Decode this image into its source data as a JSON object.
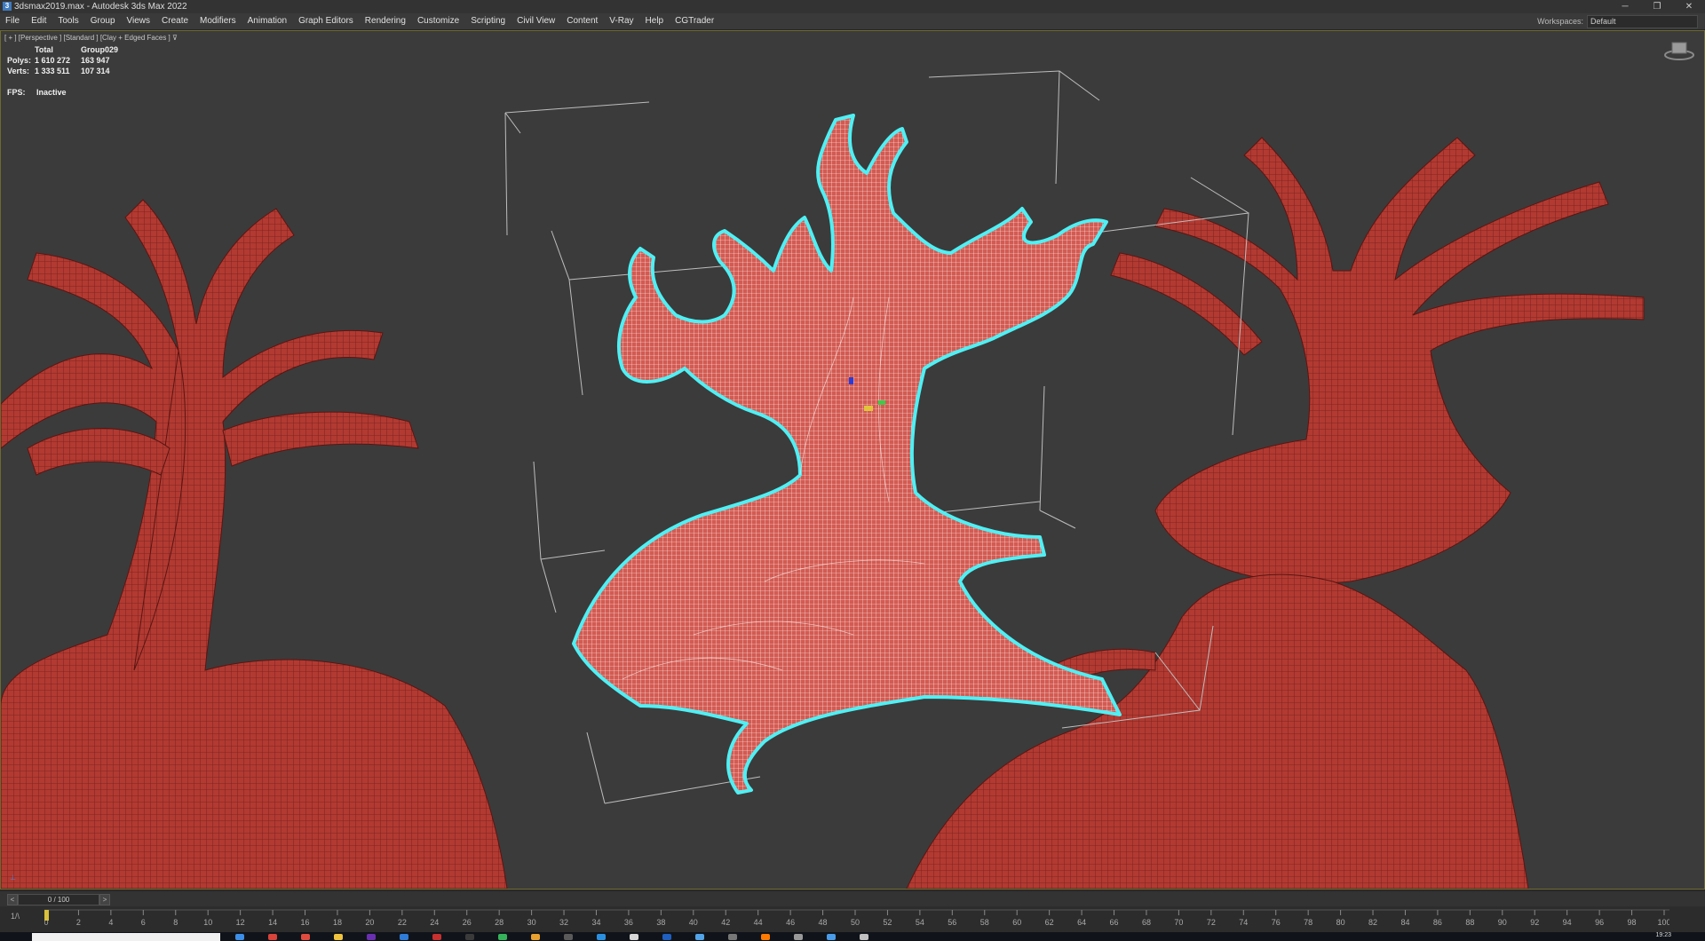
{
  "window": {
    "title": "3dsmax2019.max - Autodesk 3ds Max 2022",
    "icon": "3ds-max-app-icon",
    "buttons": [
      "─",
      "❐",
      "✕"
    ]
  },
  "menu": {
    "items": [
      "File",
      "Edit",
      "Tools",
      "Group",
      "Views",
      "Create",
      "Modifiers",
      "Animation",
      "Graph Editors",
      "Rendering",
      "Customize",
      "Scripting",
      "Civil View",
      "Content",
      "V-Ray",
      "Help",
      "CGTrader"
    ],
    "workspace_label": "Workspaces:",
    "workspace_value": "Default"
  },
  "viewport": {
    "label": "[ + ] [Perspective ] [Standard ] [Clay + Edged Faces ]",
    "filter_icon": "filter-icon",
    "stats": {
      "header": [
        "",
        "Total",
        "Group029"
      ],
      "rows": [
        {
          "label": "Polys:",
          "total": "1 610 272",
          "selected": "163 947"
        },
        {
          "label": "Verts:",
          "total": "1 333 511",
          "selected": "107 314"
        }
      ]
    },
    "fps_label": "FPS:",
    "fps_value": "Inactive",
    "colors": {
      "mesh": "#b23a32",
      "selection_outline": "#4ff0f4",
      "background": "#3b3b3b"
    }
  },
  "timeline": {
    "slider": "0 / 100",
    "prev": "<",
    "next": ">",
    "mode_label": "1/\\",
    "ticks": [
      "0",
      "2",
      "4",
      "6",
      "8",
      "10",
      "12",
      "14",
      "16",
      "18",
      "20",
      "22",
      "24",
      "26",
      "28",
      "30",
      "32",
      "34",
      "36",
      "38",
      "40",
      "42",
      "44",
      "46",
      "48",
      "50",
      "52",
      "54",
      "56",
      "58",
      "60",
      "62",
      "64",
      "66",
      "68",
      "70",
      "72",
      "74",
      "76",
      "78",
      "80",
      "82",
      "84",
      "86",
      "88",
      "90",
      "92",
      "94",
      "96",
      "98",
      "100"
    ]
  },
  "taskbar": {
    "clock": "19:23",
    "colors": [
      "#3c8ee6",
      "#d8433a",
      "#e04b3f",
      "#f0c33f",
      "#6a2fb0",
      "#2f7bd8",
      "#c7302f",
      "#3a3a3a",
      "#35b35a",
      "#e9a12f",
      "#5a5a5a",
      "#2b8fe0",
      "#d7d7d7",
      "#1f5fbf",
      "#52a3e8",
      "#777",
      "#ff7a00",
      "#999",
      "#4a9be8",
      "#c0c0c0"
    ]
  }
}
